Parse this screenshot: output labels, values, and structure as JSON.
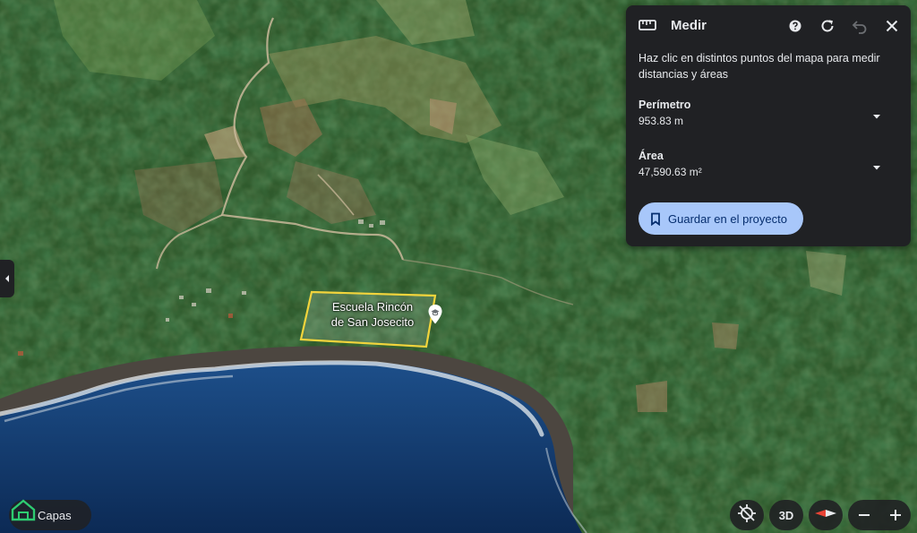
{
  "measure_panel": {
    "title": "Medir",
    "instructions": "Haz clic en distintos puntos del mapa para medir distancias y áreas",
    "perimeter": {
      "label": "Perímetro",
      "value": "953.83 m"
    },
    "area": {
      "label": "Área",
      "value": "47,590.63 m²"
    },
    "save_label": "Guardar en el proyecto"
  },
  "map": {
    "place_label_line1": "Escuela Rincón",
    "place_label_line2": "de San Josecito",
    "polygon_color": "#f2d43c"
  },
  "layers": {
    "label": "Capas"
  },
  "controls": {
    "view_3d_label": "3D"
  },
  "icons": [
    "ruler-icon",
    "help-icon",
    "refresh-icon",
    "undo-icon",
    "close-icon",
    "chevron-down-icon",
    "bookmark-icon",
    "school-pin-icon",
    "collapse-left-icon",
    "recenter-icon",
    "compass-icon",
    "zoom-out-icon",
    "zoom-in-icon"
  ],
  "colors": {
    "accent": "#a8c7fa",
    "panel_bg": "#202124"
  }
}
